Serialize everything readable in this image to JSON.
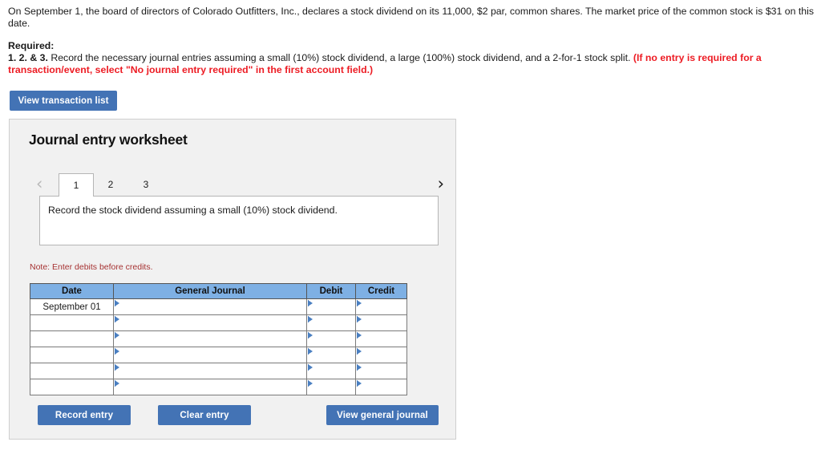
{
  "problem": {
    "statement": "On September 1, the board of directors of Colorado Outfitters, Inc., declares a stock dividend on its 11,000, $2 par, common shares. The market price of the common stock is $31 on this date."
  },
  "required": {
    "label": "Required:",
    "numbers": "1. 2. & 3.",
    "instruction": " Record the necessary journal entries assuming a small (10%) stock dividend, a large (100%) stock dividend, and a 2-for-1 stock split. ",
    "note_red": "(If no entry is required for a transaction/event, select \"No journal entry required\" in the first account field.)"
  },
  "toolbar": {
    "view_transaction_list": "View transaction list"
  },
  "worksheet": {
    "title": "Journal entry worksheet",
    "nav": {
      "prev_icon": "chevron-left-icon",
      "next_icon": "chevron-right-icon",
      "prev_glyph": "‹",
      "next_glyph": "›"
    },
    "tabs": [
      {
        "label": "1",
        "active": true
      },
      {
        "label": "2",
        "active": false
      },
      {
        "label": "3",
        "active": false
      }
    ],
    "prompt": "Record the stock dividend assuming a small (10%) stock dividend.",
    "note": "Note: Enter debits before credits.",
    "table": {
      "headers": [
        "Date",
        "General Journal",
        "Debit",
        "Credit"
      ],
      "rows": [
        {
          "date": "September 01",
          "general_journal": "",
          "debit": "",
          "credit": ""
        },
        {
          "date": "",
          "general_journal": "",
          "debit": "",
          "credit": ""
        },
        {
          "date": "",
          "general_journal": "",
          "debit": "",
          "credit": ""
        },
        {
          "date": "",
          "general_journal": "",
          "debit": "",
          "credit": ""
        },
        {
          "date": "",
          "general_journal": "",
          "debit": "",
          "credit": ""
        },
        {
          "date": "",
          "general_journal": "",
          "debit": "",
          "credit": ""
        }
      ]
    },
    "buttons": {
      "record_entry": "Record entry",
      "clear_entry": "Clear entry",
      "view_general_journal": "View general journal"
    }
  },
  "colors": {
    "button_blue": "#4373b5",
    "table_header_blue": "#7eb0e4",
    "alert_red": "#ed1c24",
    "note_red": "#a63232",
    "panel_gray": "#f1f1f1"
  }
}
